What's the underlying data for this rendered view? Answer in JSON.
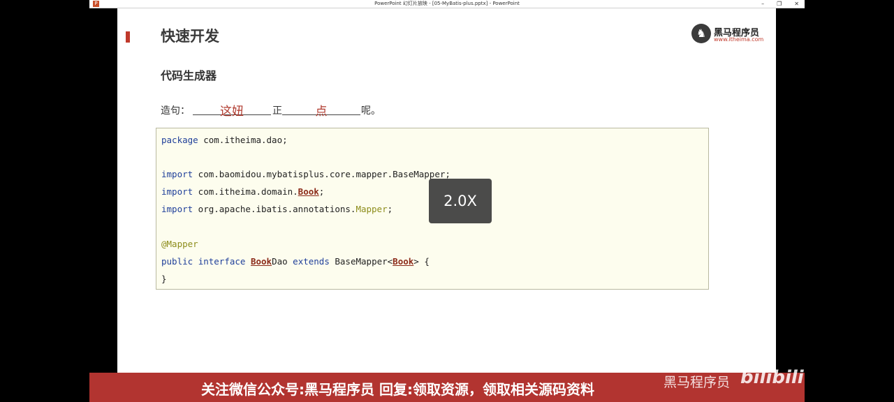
{
  "window": {
    "title": "PowerPoint 幻灯片放映 - [05-MyBatis-plus.pptx] - PowerPoint",
    "buttons": {
      "minimize": "–",
      "restore": "❐",
      "close": "✕"
    }
  },
  "slide": {
    "title": "快速开发",
    "subtitle": "代码生成器",
    "logo": {
      "name": "黑马程序员",
      "url": "www.itheima.com"
    },
    "sentence": {
      "prefix": "造句：",
      "blank1": "这妞",
      "middle": "正",
      "blank2": "点",
      "suffix": "呢。"
    },
    "code": {
      "line1_kw": "package",
      "line1_rest": " com.itheima.dao;",
      "line3_kw": "import",
      "line3_rest": " com.baomidou.mybatisplus.core.mapper.BaseMapper;",
      "line4_kw": "import",
      "line4_mid": " com.itheima.domain.",
      "line4_ref": "Book",
      "line4_end": ";",
      "line5_kw": "import",
      "line5_mid": " org.apache.ibatis.annotations.",
      "line5_ann": "Mapper",
      "line5_end": ";",
      "line7_ann": "@Mapper",
      "line8_kw1": "public",
      "line8_kw2": "interface",
      "line8_ref1": "Book",
      "line8_txt1": "Dao ",
      "line8_kw3": "extends",
      "line8_txt2": " BaseMapper<",
      "line8_ref2": "Book",
      "line8_txt3": "> {",
      "line9": "}"
    }
  },
  "overlay": {
    "speed": "2.0X"
  },
  "banner": {
    "text": "关注微信公众号:黑马程序员  回复:领取资源，领取相关源码资料",
    "watermark": "黑马程序员",
    "bili": "bilibili"
  }
}
